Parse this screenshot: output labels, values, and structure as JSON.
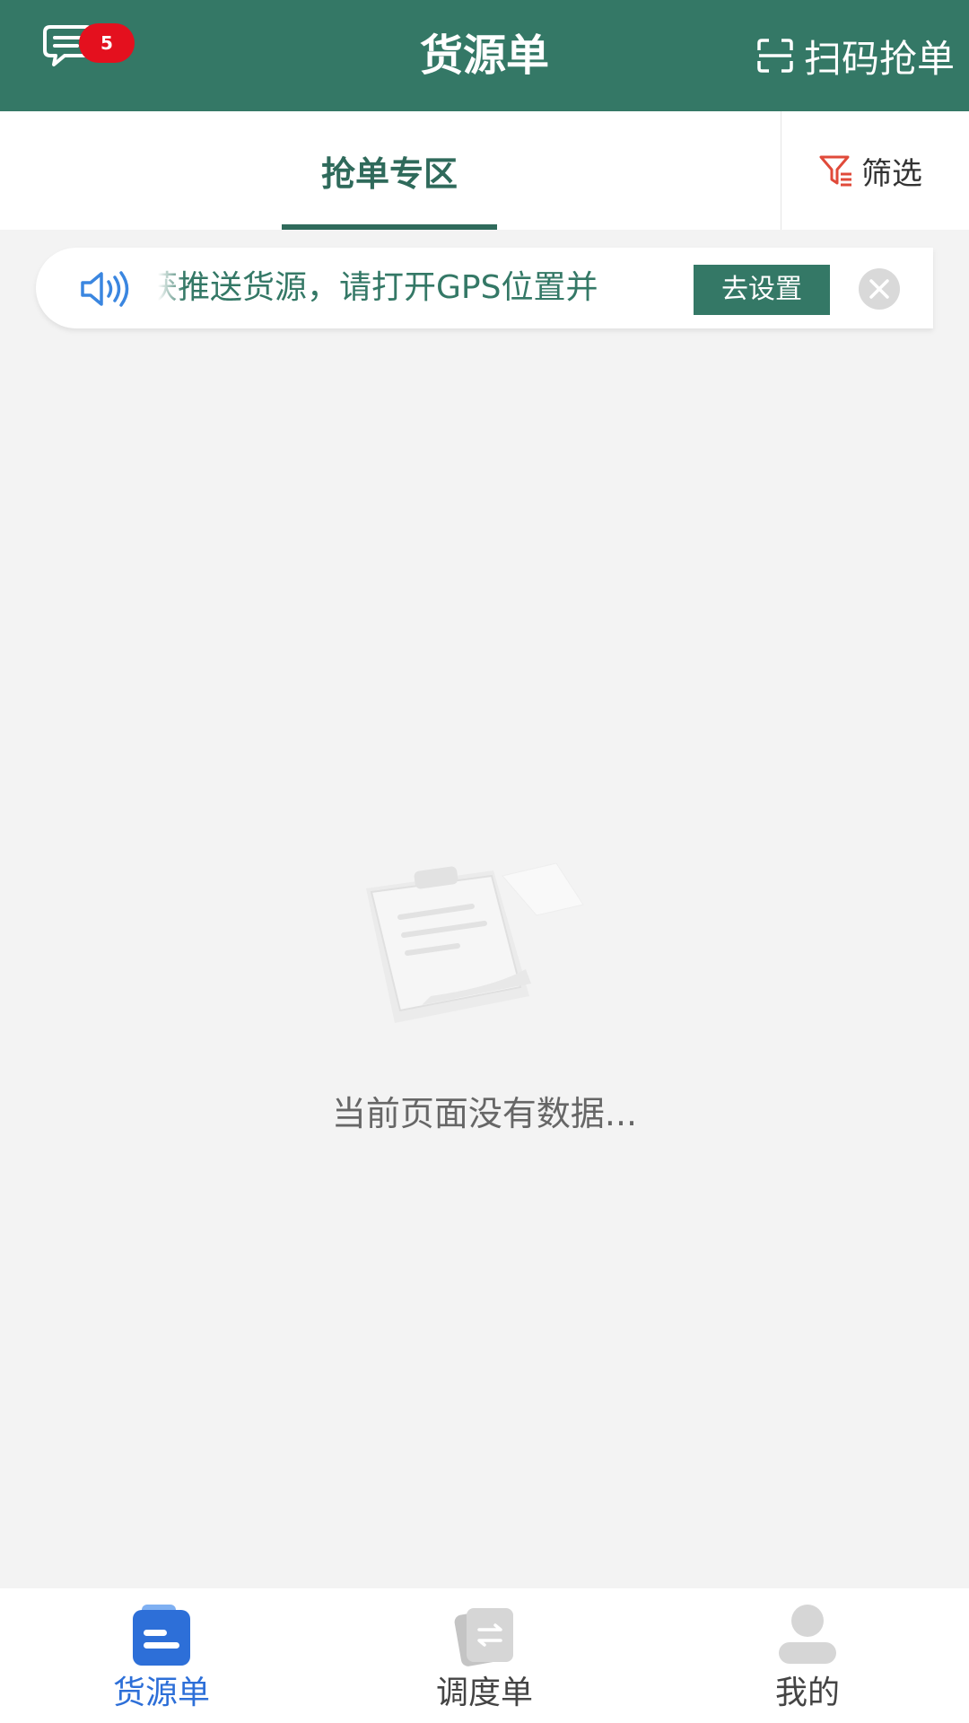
{
  "header": {
    "title": "货源单",
    "message_badge": "5",
    "scan_label": "扫码抢单"
  },
  "tabs": {
    "active_label": "抢单专区",
    "filter_label": "筛选"
  },
  "notice": {
    "text": "获推送货源，请打开GPS位置并",
    "button_label": "去设置"
  },
  "empty_state": {
    "text": "当前页面没有数据..."
  },
  "bottom_nav": {
    "items": [
      {
        "label": "货源单",
        "icon": "document-icon",
        "active": true
      },
      {
        "label": "调度单",
        "icon": "dispatch-icon",
        "active": false
      },
      {
        "label": "我的",
        "icon": "profile-icon",
        "active": false
      }
    ]
  },
  "colors": {
    "brand_green": "#347866",
    "badge_red": "#e4101e",
    "active_blue": "#2d6fd8"
  }
}
